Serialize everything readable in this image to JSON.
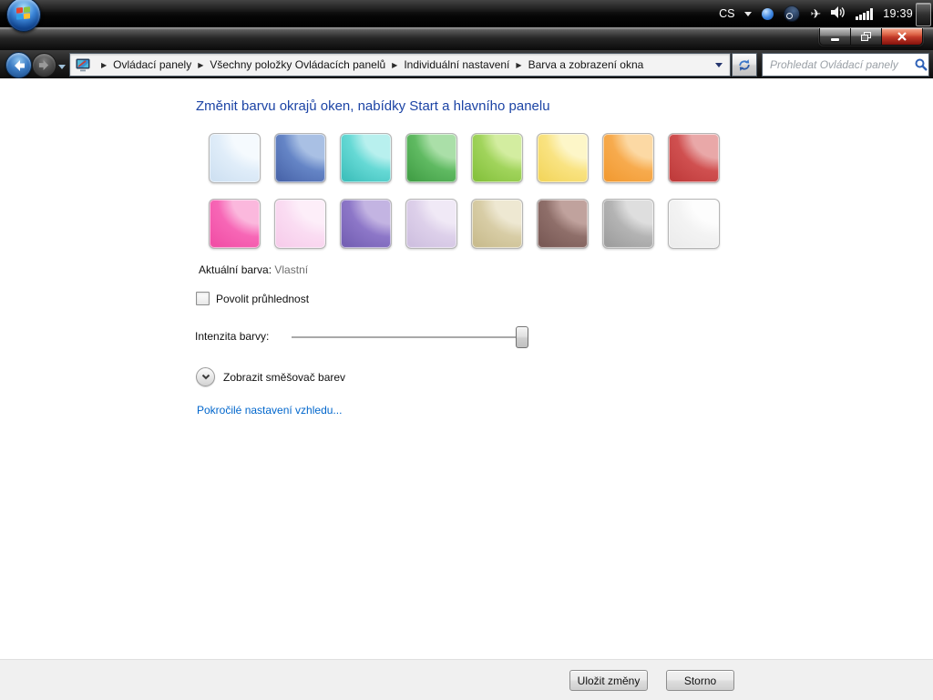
{
  "taskbar": {
    "language_indicator": "CS",
    "clock": "19:39",
    "apps": [
      {
        "name": "firefox",
        "active": false
      },
      {
        "name": "dota",
        "active": false
      },
      {
        "name": "personalization",
        "active": true
      }
    ]
  },
  "navbar": {
    "breadcrumb": [
      "Ovládací panely",
      "Všechny položky Ovládacích panelů",
      "Individuální nastavení",
      "Barva a zobrazení okna"
    ],
    "search": {
      "placeholder": "Prohledat Ovládací panely"
    }
  },
  "window": {
    "heading": "Změnit barvu okrajů oken, nabídky Start a hlavního panelu",
    "current_color_label": "Aktuální barva:",
    "current_color_value": "Vlastní",
    "transparency_checkbox_label": "Povolit průhlednost",
    "transparency_checked": false,
    "intensity_label": "Intenzita barvy:",
    "intensity_percent": 100,
    "mixer_toggle_label": "Zobrazit směšovač barev",
    "advanced_link_label": "Pokročilé nastavení vzhledu...",
    "save_button_label": "Uložit změny",
    "cancel_button_label": "Storno",
    "swatches": [
      {
        "name": "sky",
        "light": "#f5fafe",
        "base": "#e0edf9",
        "dark": "#cfe1f2"
      },
      {
        "name": "twilight",
        "light": "#a9c0e4",
        "base": "#6585c6",
        "dark": "#4a66ab"
      },
      {
        "name": "sea",
        "light": "#b8f0ee",
        "base": "#66d9d5",
        "dark": "#3fc0bc"
      },
      {
        "name": "leaf",
        "light": "#aadfa8",
        "base": "#60ba62",
        "dark": "#43a047"
      },
      {
        "name": "lime",
        "light": "#d3eda0",
        "base": "#a1d45c",
        "dark": "#86c23e"
      },
      {
        "name": "sun",
        "light": "#fdf6c8",
        "base": "#f9e382",
        "dark": "#f3d65e"
      },
      {
        "name": "pumpkin",
        "light": "#fcd9a4",
        "base": "#f7ab4e",
        "dark": "#f29b33"
      },
      {
        "name": "ruby",
        "light": "#e9a8a8",
        "base": "#d05050",
        "dark": "#c03c3c"
      },
      {
        "name": "fuchsia",
        "light": "#fbb8dd",
        "base": "#f767b6",
        "dark": "#f14fa6"
      },
      {
        "name": "blush",
        "light": "#fdeef9",
        "base": "#fadcf2",
        "dark": "#f7cdeb"
      },
      {
        "name": "violet",
        "light": "#c3b4e2",
        "base": "#8d77c8",
        "dark": "#7560b4"
      },
      {
        "name": "lavender",
        "light": "#f0e9f6",
        "base": "#ddd0ea",
        "dark": "#cfc0e0"
      },
      {
        "name": "taupe",
        "light": "#eee8d2",
        "base": "#d8cda6",
        "dark": "#c9bc8e"
      },
      {
        "name": "chocolate",
        "light": "#c0a29d",
        "base": "#8f6f6a",
        "dark": "#7a5a56"
      },
      {
        "name": "slate",
        "light": "#dedede",
        "base": "#b4b4b4",
        "dark": "#9e9e9e"
      },
      {
        "name": "frost",
        "light": "#fdfdfd",
        "base": "#f3f3f3",
        "dark": "#ececec"
      }
    ]
  },
  "colors": {
    "heading_blue": "#1c44a5",
    "link_blue": "#0066cc",
    "muted_value": "#6f6f6f",
    "close_button_red": "#c13a28"
  }
}
